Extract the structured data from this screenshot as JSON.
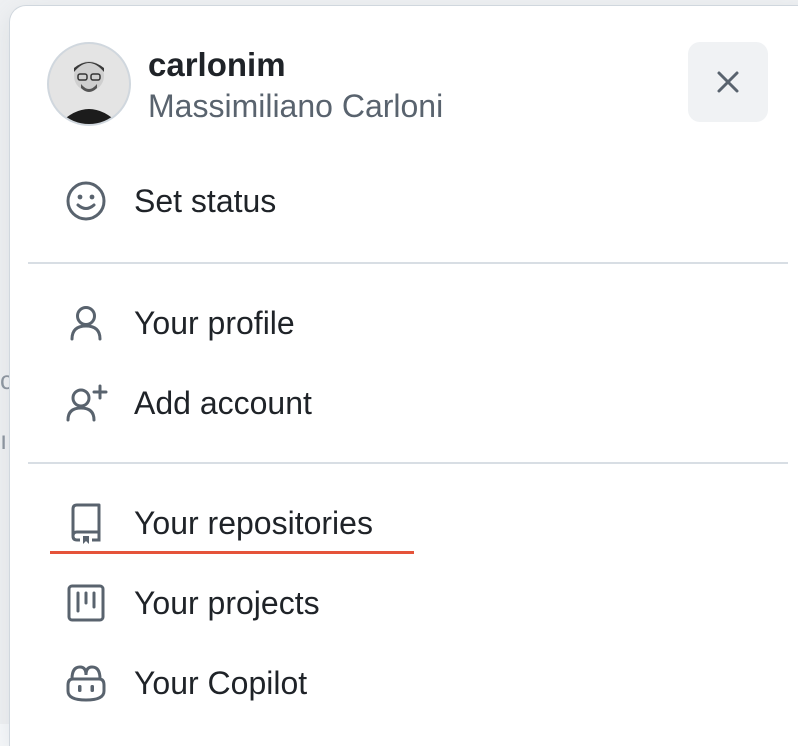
{
  "user": {
    "username": "carlonim",
    "full_name": "Massimiliano Carloni"
  },
  "menu": {
    "set_status": "Set status",
    "your_profile": "Your profile",
    "add_account": "Add account",
    "your_repositories": "Your repositories",
    "your_projects": "Your projects",
    "your_copilot": "Your Copilot"
  },
  "icons": {
    "close": "close-icon",
    "smiley": "smiley-icon",
    "person": "person-icon",
    "person_add": "person-add-icon",
    "repo": "repo-icon",
    "project": "project-icon",
    "copilot": "copilot-icon"
  },
  "colors": {
    "text": "#1f2328",
    "muted": "#59636e",
    "annotation_underline": "#e5533a"
  }
}
